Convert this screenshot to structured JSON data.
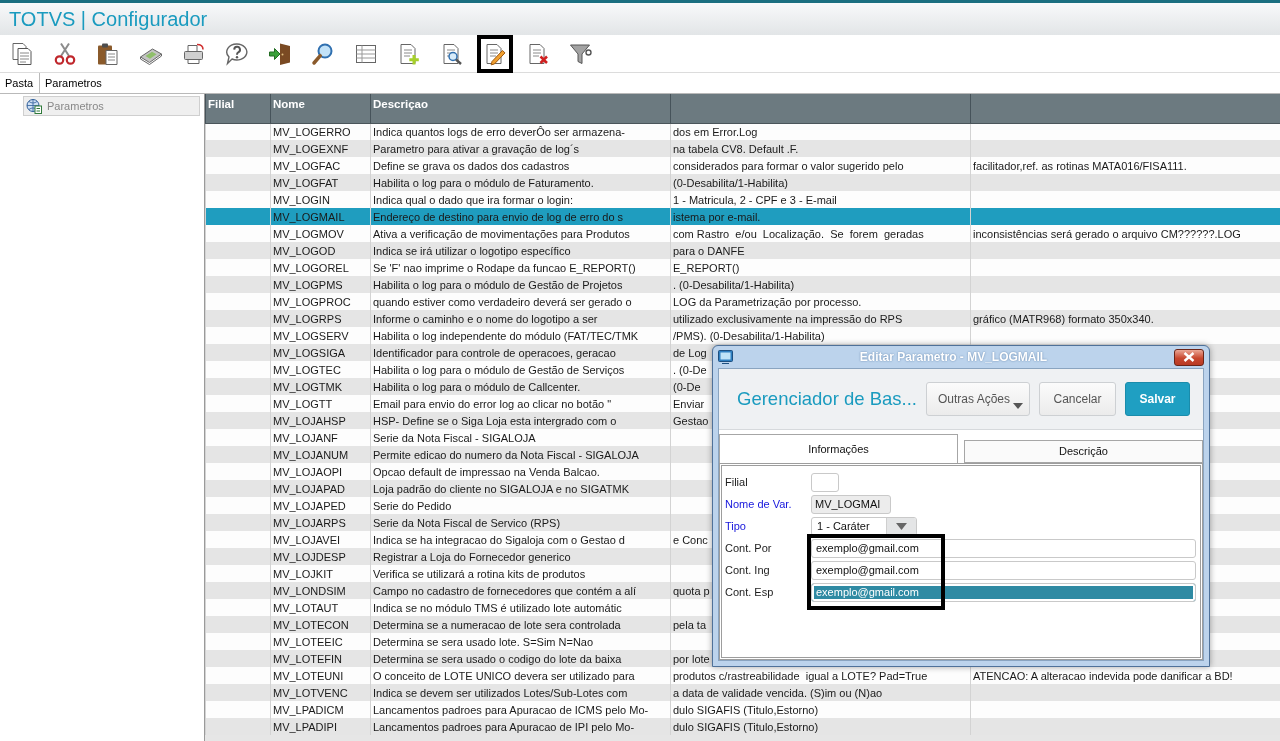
{
  "window": {
    "title": "TOTVS | Configurador"
  },
  "toolbar": [
    {
      "kind": "copy",
      "highlighted": false
    },
    {
      "kind": "cut",
      "highlighted": false
    },
    {
      "kind": "paste",
      "highlighted": false
    },
    {
      "kind": "calculator",
      "highlighted": false
    },
    {
      "kind": "print",
      "highlighted": false
    },
    {
      "kind": "help",
      "highlighted": false
    },
    {
      "kind": "exit",
      "highlighted": false
    },
    {
      "kind": "search",
      "highlighted": false
    },
    {
      "kind": "grid",
      "highlighted": false
    },
    {
      "kind": "add",
      "highlighted": false
    },
    {
      "kind": "preview",
      "highlighted": false
    },
    {
      "kind": "edit",
      "highlighted": true
    },
    {
      "kind": "delete",
      "highlighted": false
    },
    {
      "kind": "filter",
      "highlighted": false
    }
  ],
  "folder_bar": {
    "tab": "Pasta",
    "title": "Parametros"
  },
  "sidebar": {
    "items": [
      {
        "label": "Parametros",
        "selected": true
      }
    ]
  },
  "table": {
    "columns": [
      "Filial",
      "Nome",
      "Descriçao"
    ],
    "rows": [
      {
        "name": "MV_LOGERRO",
        "description": "Indica quantos logs de erro deverÔo ser armazena-",
        "column_4": "dos em Error.Log",
        "selected": false
      },
      {
        "name": "MV_LOGEXNF",
        "description": "Parametro para ativar a gravação de log´s",
        "column_4": "na tabela CV8. Default .F.",
        "selected": false
      },
      {
        "name": "MV_LOGFAC",
        "description": "Define se grava os dados dos cadastros",
        "column_4": "considerados para formar o valor sugerido pelo",
        "column_5": "facilitador,ref. as rotinas MATA016/FISA111.",
        "selected": false
      },
      {
        "name": "MV_LOGFAT",
        "description": "Habilita o log para o módulo de Faturamento.",
        "column_4": "(0-Desabilita/1-Habilita)",
        "selected": false
      },
      {
        "name": "MV_LOGIN",
        "description": "Indica qual o dado que ira formar o login:",
        "column_4": "1 - Matricula, 2 - CPF e 3 - E-mail",
        "selected": false
      },
      {
        "name": "MV_LOGMAIL",
        "description": "Endereço de destino para envio de log de erro do s",
        "column_4": "istema por e-mail.",
        "selected": true
      },
      {
        "name": "MV_LOGMOV",
        "description": "Ativa a verificação de movimentações para Produtos",
        "column_4": "com Rastro  e/ou  Localização.  Se  forem  geradas",
        "column_5": "inconsistências será gerado o arquivo CM??????.LOG",
        "selected": false
      },
      {
        "name": "MV_LOGOD",
        "description": "Indica se irá utilizar o logotipo específico",
        "column_4": "para o DANFE",
        "selected": false
      },
      {
        "name": "MV_LOGOREL",
        "description": "Se 'F' nao imprime o Rodape da funcao E_REPORT()",
        "column_4": "E_REPORT()",
        "selected": false
      },
      {
        "name": "MV_LOGPMS",
        "description": "Habilita o log para o módulo de Gestão de Projetos",
        "column_4": ". (0-Desabilita/1-Habilita)",
        "selected": false
      },
      {
        "name": "MV_LOGPROC",
        "description": "quando estiver como verdadeiro deverá ser gerado o",
        "column_4": "LOG da Parametrização por processo.",
        "selected": false
      },
      {
        "name": "MV_LOGRPS",
        "description": "Informe o caminho e o nome do logotipo a ser",
        "column_4": "utilizado exclusivamente na impressão do RPS",
        "column_5": "gráfico (MATR968) formato 350x340.",
        "selected": false
      },
      {
        "name": "MV_LOGSERV",
        "description": "Habilita o log independente do módulo (FAT/TEC/TMK",
        "column_4": "/PMS). (0-Desabilita/1-Habilita)",
        "selected": false
      },
      {
        "name": "MV_LOGSIGA",
        "description": "Identificador para controle de operacoes, geracao",
        "column_4": "de Log",
        "selected": false
      },
      {
        "name": "MV_LOGTEC",
        "description": "Habilita o log para o módulo de Gestão de Serviços",
        "column_4": ". (0-De",
        "selected": false
      },
      {
        "name": "MV_LOGTMK",
        "description": "Habilita o log para o módulo de Callcenter.",
        "column_4": "(0-De",
        "selected": false
      },
      {
        "name": "MV_LOGTT",
        "description": "Email para envio do error log ao clicar no botão \"",
        "column_4": "Enviar",
        "selected": false
      },
      {
        "name": "MV_LOJAHSP",
        "description": "HSP- Define se o Siga Loja esta intergrado com o",
        "column_4": "Gestao",
        "selected": false
      },
      {
        "name": "MV_LOJANF",
        "description": "Serie da Nota Fiscal - SIGALOJA",
        "selected": false
      },
      {
        "name": "MV_LOJANUM",
        "description": "Permite edicao do numero da Nota Fiscal - SIGALOJA",
        "selected": false
      },
      {
        "name": "MV_LOJAOPI",
        "description": "Opcao default de impressao na Venda Balcao.",
        "selected": false
      },
      {
        "name": "MV_LOJAPAD",
        "description": "Loja padrão do cliente no SIGALOJA e no SIGATMK",
        "selected": false
      },
      {
        "name": "MV_LOJAPED",
        "description": "Serie do Pedido",
        "selected": false
      },
      {
        "name": "MV_LOJARPS",
        "description": "Serie da Nota Fiscal de Servico (RPS)",
        "selected": false
      },
      {
        "name": "MV_LOJAVEI",
        "description": "Indica se ha integracao do Sigaloja com o Gestao d",
        "column_4": "e Conc",
        "selected": false
      },
      {
        "name": "MV_LOJDESP",
        "description": "Registrar a Loja do Fornecedor generico",
        "selected": false
      },
      {
        "name": "MV_LOJKIT",
        "description": "Verifica se utilizará a rotina kits de produtos",
        "selected": false
      },
      {
        "name": "MV_LONDSIM",
        "description": "Campo no cadastro de fornecedores que contém a alí",
        "column_4": "quota p",
        "selected": false
      },
      {
        "name": "MV_LOTAUT",
        "description": "Indica se no módulo TMS é utilizado lote automátic",
        "selected": false
      },
      {
        "name": "MV_LOTECON",
        "description": "Determina se a numeracao de lote sera controlada",
        "column_4": "pela ta",
        "selected": false
      },
      {
        "name": "MV_LOTEEIC",
        "description": "Determina se sera usado lote. S=Sim N=Nao",
        "selected": false
      },
      {
        "name": "MV_LOTEFIN",
        "description": "Determina se sera usado o codigo do lote da baixa",
        "column_4": "por lote",
        "selected": false
      },
      {
        "name": "MV_LOTEUNI",
        "description": "O conceito de LOTE UNICO devera ser utilizado para",
        "column_4": "produtos c/rastreabilidade  igual a LOTE? Pad=True",
        "column_5": "ATENCAO: A alteracao indevida pode danificar a BD!",
        "selected": false
      },
      {
        "name": "MV_LOTVENC",
        "description": "Indica se devem ser utilizados Lotes/Sub-Lotes com",
        "column_4": "a data de validade vencida. (S)im ou (N)ao",
        "selected": false
      },
      {
        "name": "MV_LPADICM",
        "description": "Lancamentos padroes para Apuracao de ICMS pelo Mo-",
        "column_4": "dulo SIGAFIS (Titulo,Estorno)",
        "selected": false
      },
      {
        "name": "MV_LPADIPI",
        "description": "Lancamentos padroes para Apuracao de IPI pelo Mo-",
        "column_4": "dulo SIGAFIS (Titulo,Estorno)",
        "selected": false
      }
    ]
  },
  "dialog": {
    "title": "Editar Parametro - MV_LOGMAIL",
    "heading": "Gerenciador de Bas...",
    "buttons": [
      {
        "label": "Outras Ações",
        "kind": "menu"
      },
      {
        "label": "Cancelar",
        "kind": "default"
      },
      {
        "label": "Salvar",
        "kind": "primary"
      }
    ],
    "tabs": [
      {
        "label": "Informações",
        "selected": true
      },
      {
        "label": "Descrição",
        "selected": false
      }
    ],
    "fields": [
      {
        "label": "Filial",
        "kind": "short",
        "required": false,
        "disabled": false,
        "highlighted": false,
        "text_selected": false
      },
      {
        "label": "Nome de Var.",
        "kind": "medium",
        "value": "MV_LOGMAI",
        "required": true,
        "disabled": true,
        "highlighted": false,
        "text_selected": false
      },
      {
        "label": "Tipo",
        "kind": "select",
        "value": "1 - Caráter",
        "required": true,
        "disabled": false,
        "highlighted": false,
        "text_selected": false
      },
      {
        "label": "Cont. Por",
        "kind": "wide",
        "value": "exemplo@gmail.com",
        "required": false,
        "disabled": false,
        "highlighted": true,
        "text_selected": false
      },
      {
        "label": "Cont. Ing",
        "kind": "wide",
        "value": "exemplo@gmail.com",
        "required": false,
        "disabled": false,
        "highlighted": true,
        "text_selected": false
      },
      {
        "label": "Cont. Esp",
        "kind": "wide",
        "value": "exemplo@gmail.com",
        "required": false,
        "disabled": false,
        "highlighted": true,
        "text_selected": true
      }
    ]
  }
}
